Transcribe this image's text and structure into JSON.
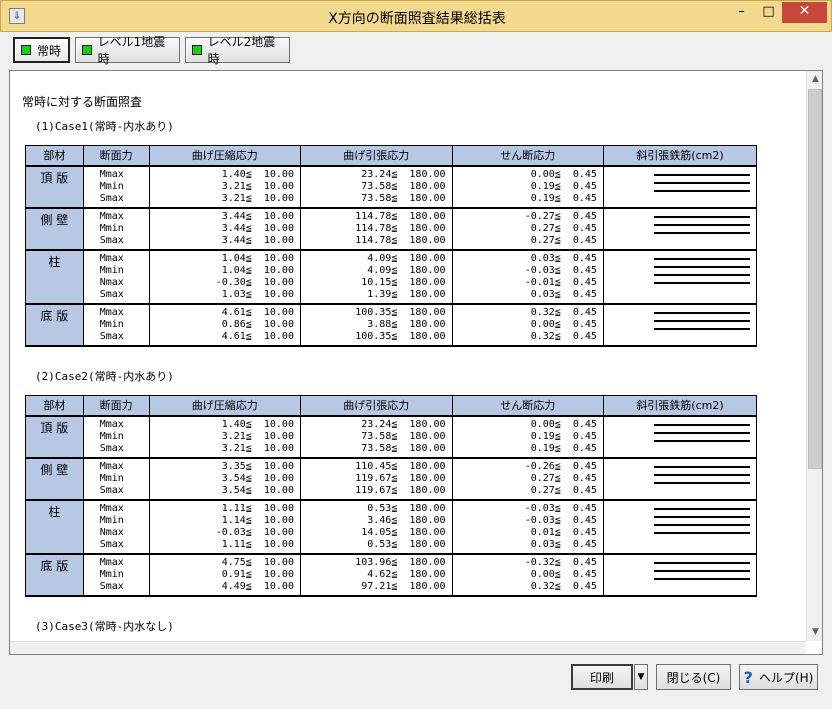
{
  "window": {
    "title": "X方向の断面照査結果総括表",
    "min_glyph": "–",
    "max_glyph": "□",
    "close_glyph": "✕",
    "app_icon": "app-icon"
  },
  "toolbar": {
    "buttons": [
      {
        "label": "常時"
      },
      {
        "label": "レベル1地震時"
      },
      {
        "label": "レベル2地震時"
      }
    ]
  },
  "report": {
    "heading": "常時に対する断面照査",
    "columns": [
      "部材",
      "断面力",
      "曲げ圧縮応力",
      "曲げ引張応力",
      "せん断応力",
      "斜引張鉄筋(cm2)"
    ],
    "cases": [
      {
        "title": "(1)Case1(常時-内水あり)",
        "rows": [
          {
            "member": "頂 版",
            "forces": [
              "Mmax",
              "Mmin",
              "Smax"
            ],
            "comp": [
              "1.40≦  10.00",
              "3.21≦  10.00",
              "3.21≦  10.00"
            ],
            "tens": [
              "23.24≦  180.00",
              "73.58≦  180.00",
              "73.58≦  180.00"
            ],
            "shear": [
              "0.00≦  0.45",
              "0.19≦  0.45",
              "0.19≦  0.45"
            ]
          },
          {
            "member": "側 壁",
            "forces": [
              "Mmax",
              "Mmin",
              "Smax"
            ],
            "comp": [
              "3.44≦  10.00",
              "3.44≦  10.00",
              "3.44≦  10.00"
            ],
            "tens": [
              "114.78≦  180.00",
              "114.78≦  180.00",
              "114.78≦  180.00"
            ],
            "shear": [
              "-0.27≦  0.45",
              "0.27≦  0.45",
              "0.27≦  0.45"
            ]
          },
          {
            "member": "柱",
            "forces": [
              "Mmax",
              "Mmin",
              "Nmax",
              "Smax"
            ],
            "comp": [
              "1.04≦  10.00",
              "1.04≦  10.00",
              "-0.30≦  10.00",
              "1.03≦  10.00"
            ],
            "tens": [
              "4.09≦  180.00",
              "4.09≦  180.00",
              "10.15≦  180.00",
              "1.39≦  180.00"
            ],
            "shear": [
              "0.03≦  0.45",
              "-0.03≦  0.45",
              "-0.01≦  0.45",
              "0.03≦  0.45"
            ]
          },
          {
            "member": "底 版",
            "forces": [
              "Mmax",
              "Mmin",
              "Smax"
            ],
            "comp": [
              "4.61≦  10.00",
              "0.86≦  10.00",
              "4.61≦  10.00"
            ],
            "tens": [
              "100.35≦  180.00",
              "3.88≦  180.00",
              "100.35≦  180.00"
            ],
            "shear": [
              "0.32≦  0.45",
              "0.00≦  0.45",
              "0.32≦  0.45"
            ]
          }
        ]
      },
      {
        "title": "(2)Case2(常時-内水あり)",
        "rows": [
          {
            "member": "頂 版",
            "forces": [
              "Mmax",
              "Mmin",
              "Smax"
            ],
            "comp": [
              "1.40≦  10.00",
              "3.21≦  10.00",
              "3.21≦  10.00"
            ],
            "tens": [
              "23.24≦  180.00",
              "73.58≦  180.00",
              "73.58≦  180.00"
            ],
            "shear": [
              "0.00≦  0.45",
              "0.19≦  0.45",
              "0.19≦  0.45"
            ]
          },
          {
            "member": "側 壁",
            "forces": [
              "Mmax",
              "Mmin",
              "Smax"
            ],
            "comp": [
              "3.35≦  10.00",
              "3.54≦  10.00",
              "3.54≦  10.00"
            ],
            "tens": [
              "110.45≦  180.00",
              "119.67≦  180.00",
              "119.67≦  180.00"
            ],
            "shear": [
              "-0.26≦  0.45",
              "0.27≦  0.45",
              "0.27≦  0.45"
            ]
          },
          {
            "member": "柱",
            "forces": [
              "Mmax",
              "Mmin",
              "Nmax",
              "Smax"
            ],
            "comp": [
              "1.11≦  10.00",
              "1.14≦  10.00",
              "-0.03≦  10.00",
              "1.11≦  10.00"
            ],
            "tens": [
              "0.53≦  180.00",
              "3.46≦  180.00",
              "14.05≦  180.00",
              "0.53≦  180.00"
            ],
            "shear": [
              "-0.03≦  0.45",
              "-0.03≦  0.45",
              "0.01≦  0.45",
              "0.03≦  0.45"
            ]
          },
          {
            "member": "底 版",
            "forces": [
              "Mmax",
              "Mmin",
              "Smax"
            ],
            "comp": [
              "4.75≦  10.00",
              "0.91≦  10.00",
              "4.49≦  10.00"
            ],
            "tens": [
              "103.96≦  180.00",
              "4.62≦  180.00",
              "97.21≦  180.00"
            ],
            "shear": [
              "-0.32≦  0.45",
              "0.00≦  0.45",
              "0.32≦  0.45"
            ]
          }
        ]
      },
      {
        "title": "(3)Case3(常時-内水なし)",
        "rows": []
      }
    ]
  },
  "footer": {
    "print_label": "印刷",
    "print_arrow": "▼",
    "close_label": "閉じる(C)",
    "help_glyph": "?",
    "help_label": "ヘルプ(H)"
  }
}
